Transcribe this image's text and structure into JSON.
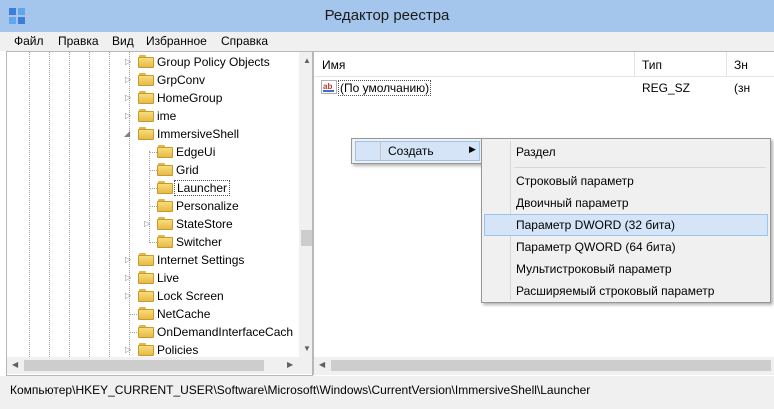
{
  "window": {
    "title": "Редактор реестра"
  },
  "menu": [
    "Файл",
    "Правка",
    "Вид",
    "Избранное",
    "Справка"
  ],
  "tree": {
    "items": [
      {
        "label": "Group Policy Objects",
        "expander": "collapsed"
      },
      {
        "label": "GrpConv",
        "expander": "collapsed"
      },
      {
        "label": "HomeGroup",
        "expander": "collapsed"
      },
      {
        "label": "ime",
        "expander": "collapsed"
      },
      {
        "label": "ImmersiveShell",
        "expander": "expanded"
      },
      {
        "label": "EdgeUi",
        "expander": "none"
      },
      {
        "label": "Grid",
        "expander": "none"
      },
      {
        "label": "Launcher",
        "expander": "none",
        "selected": true
      },
      {
        "label": "Personalize",
        "expander": "none"
      },
      {
        "label": "StateStore",
        "expander": "collapsed"
      },
      {
        "label": "Switcher",
        "expander": "none"
      },
      {
        "label": "Internet Settings",
        "expander": "collapsed"
      },
      {
        "label": "Live",
        "expander": "collapsed"
      },
      {
        "label": "Lock Screen",
        "expander": "collapsed"
      },
      {
        "label": "NetCache",
        "expander": "none"
      },
      {
        "label": "OnDemandInterfaceCach",
        "expander": "none"
      },
      {
        "label": "Policies",
        "expander": "collapsed"
      }
    ]
  },
  "columns": {
    "name": "Имя",
    "type": "Тип",
    "data": "Зн"
  },
  "values": [
    {
      "name": "(По умолчанию)",
      "type": "REG_SZ",
      "data": "(зн"
    }
  ],
  "context_menu": {
    "create_label": "Создать",
    "submenu": [
      "Раздел",
      "Строковый параметр",
      "Двоичный параметр",
      "Параметр DWORD (32 бита)",
      "Параметр QWORD (64 бита)",
      "Мультистроковый параметр",
      "Расширяемый строковый параметр"
    ],
    "highlighted_index": 3
  },
  "status": {
    "path": "Компьютер\\HKEY_CURRENT_USER\\Software\\Microsoft\\Windows\\CurrentVersion\\ImmersiveShell\\Launcher"
  },
  "colors": {
    "titlebar": "#a5c6ec",
    "highlight": "#d5e5f7",
    "highlight_border": "#99c4ee",
    "folder": "#f2cf5f"
  },
  "icons": [
    "regedit-app-icon",
    "folder-icon",
    "string-value-icon",
    "submenu-arrow-icon",
    "expand-arrow-icon",
    "collapse-arrow-icon"
  ]
}
